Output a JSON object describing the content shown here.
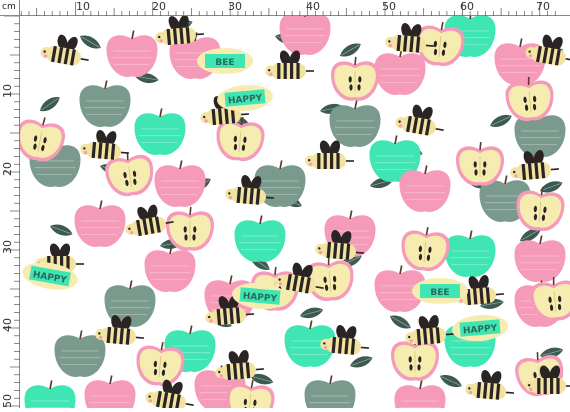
{
  "ruler": {
    "unit_label": "cm",
    "top_ticks": [
      "10",
      "20",
      "30",
      "40",
      "50",
      "60",
      "70"
    ],
    "left_ticks": [
      "10",
      "20",
      "30",
      "40",
      "50"
    ]
  },
  "pattern": {
    "motifs": [
      "bee-icon",
      "apple-icon",
      "apple-half-icon",
      "leaf-icon",
      "happy-tag"
    ],
    "happy_text": "HAPPY",
    "bee_text": "BEE",
    "colors": {
      "pink": "#f59ab9",
      "mint": "#3fe6b4",
      "sage": "#7a9a8d",
      "cream": "#f7ecb0",
      "bee_stripe": "#2a2424",
      "bee_body": "#f3e3a0",
      "leaf": "#3d5a52"
    }
  }
}
